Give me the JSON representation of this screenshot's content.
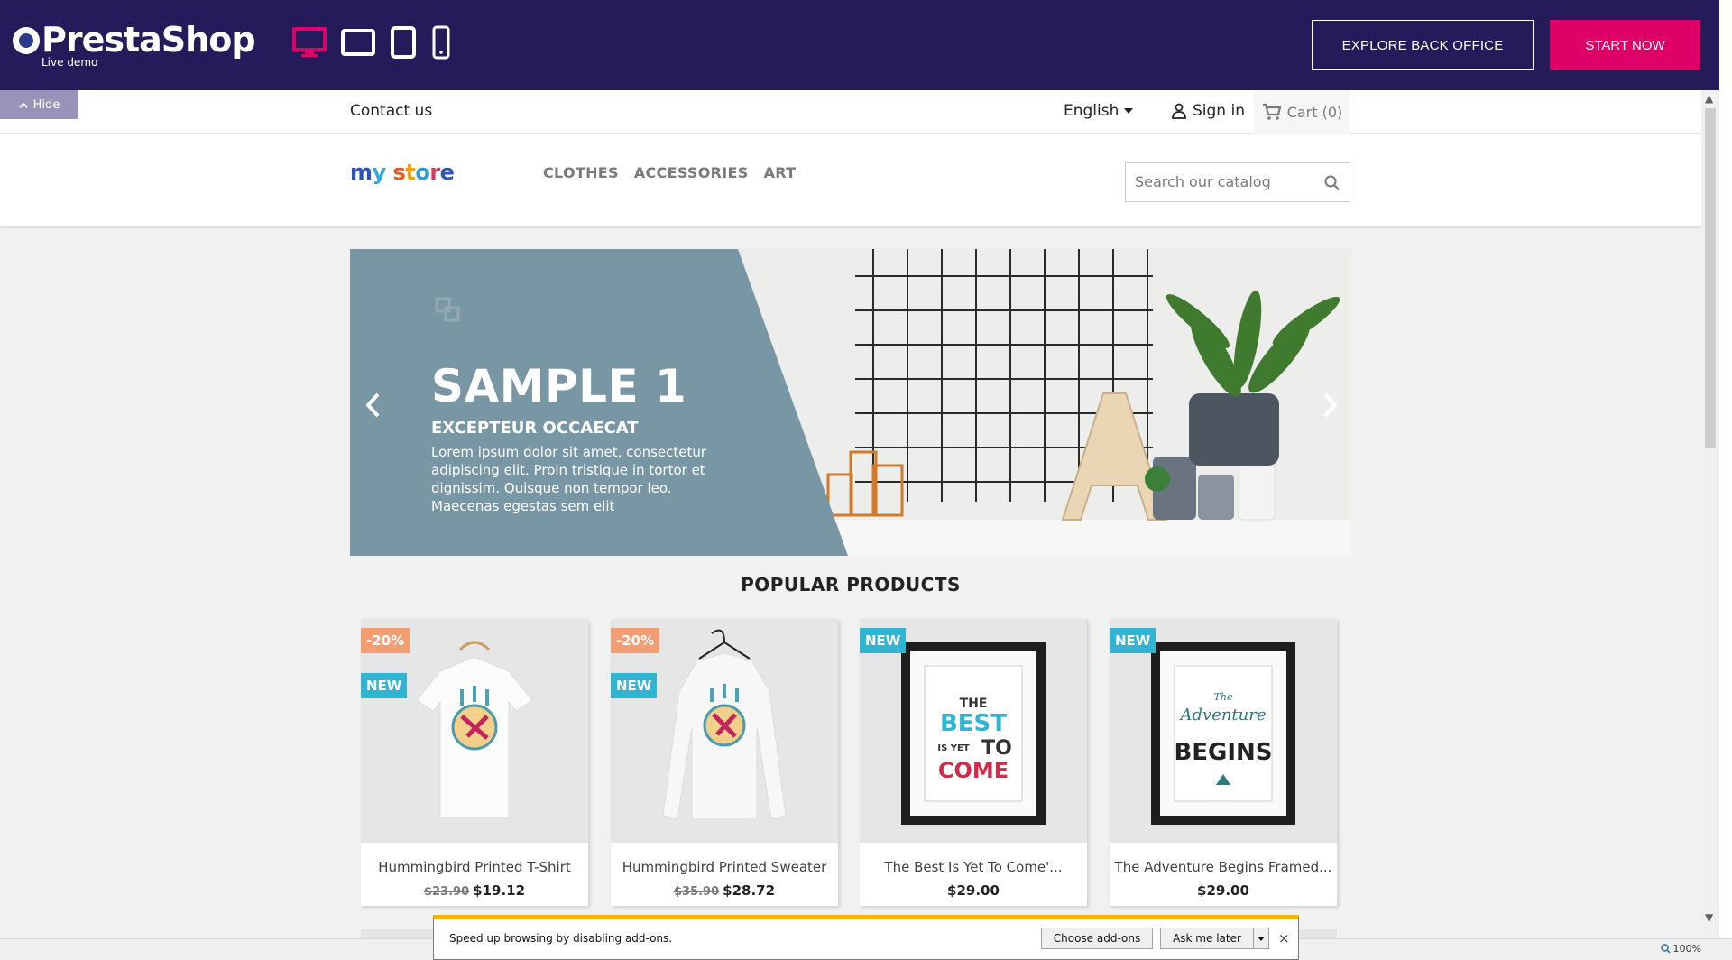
{
  "demo_bar": {
    "logo_text": "PrestaShop",
    "logo_sub": "Live demo",
    "explore_label": "EXPLORE BACK OFFICE",
    "start_label": "START NOW",
    "active_device_color": "#df0067",
    "bg_color": "#251b5b"
  },
  "hide_label": "Hide",
  "store_nav": {
    "contact": "Contact us",
    "language": "English",
    "signin": "Sign in",
    "cart": "Cart (0)"
  },
  "store_header": {
    "menu": [
      "CLOTHES",
      "ACCESSORIES",
      "ART"
    ],
    "search_placeholder": "Search our catalog"
  },
  "carousel": {
    "title": "SAMPLE 1",
    "subtitle": "EXCEPTEUR OCCAECAT",
    "text": "Lorem ipsum dolor sit amet, consectetur adipiscing elit. Proin tristique in tortor et dignissim. Quisque non tempor leo. Maecenas egestas sem elit"
  },
  "section_title": "POPULAR PRODUCTS",
  "products": [
    {
      "name": "Hummingbird Printed T-Shirt",
      "old_price": "$23.90",
      "price": "$19.12",
      "flags": [
        "-20%",
        "NEW"
      ]
    },
    {
      "name": "Hummingbird Printed Sweater",
      "old_price": "$35.90",
      "price": "$28.72",
      "flags": [
        "-20%",
        "NEW"
      ]
    },
    {
      "name": "The Best Is Yet To Come'...",
      "old_price": "",
      "price": "$29.00",
      "flags": [
        "NEW"
      ]
    },
    {
      "name": "The Adventure Begins Framed...",
      "old_price": "",
      "price": "$29.00",
      "flags": [
        "NEW"
      ]
    }
  ],
  "poster_text": {
    "best": [
      "THE",
      "BEST",
      "IS YET",
      "TO",
      "COME"
    ],
    "adventure": [
      "The",
      "Adventure",
      "BEGINS"
    ]
  },
  "notification": {
    "text": "Speed up browsing by disabling add-ons.",
    "choose": "Choose add-ons",
    "later": "Ask me later",
    "close": "×"
  },
  "zoom": "100%"
}
